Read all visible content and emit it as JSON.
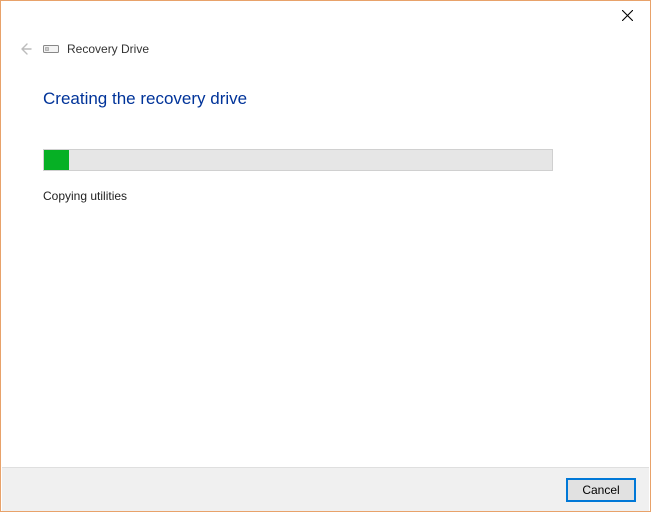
{
  "window": {
    "title": "Recovery Drive"
  },
  "page": {
    "heading": "Creating the recovery drive",
    "status_text": "Copying utilities",
    "progress_percent": 5
  },
  "footer": {
    "cancel_label": "Cancel"
  }
}
